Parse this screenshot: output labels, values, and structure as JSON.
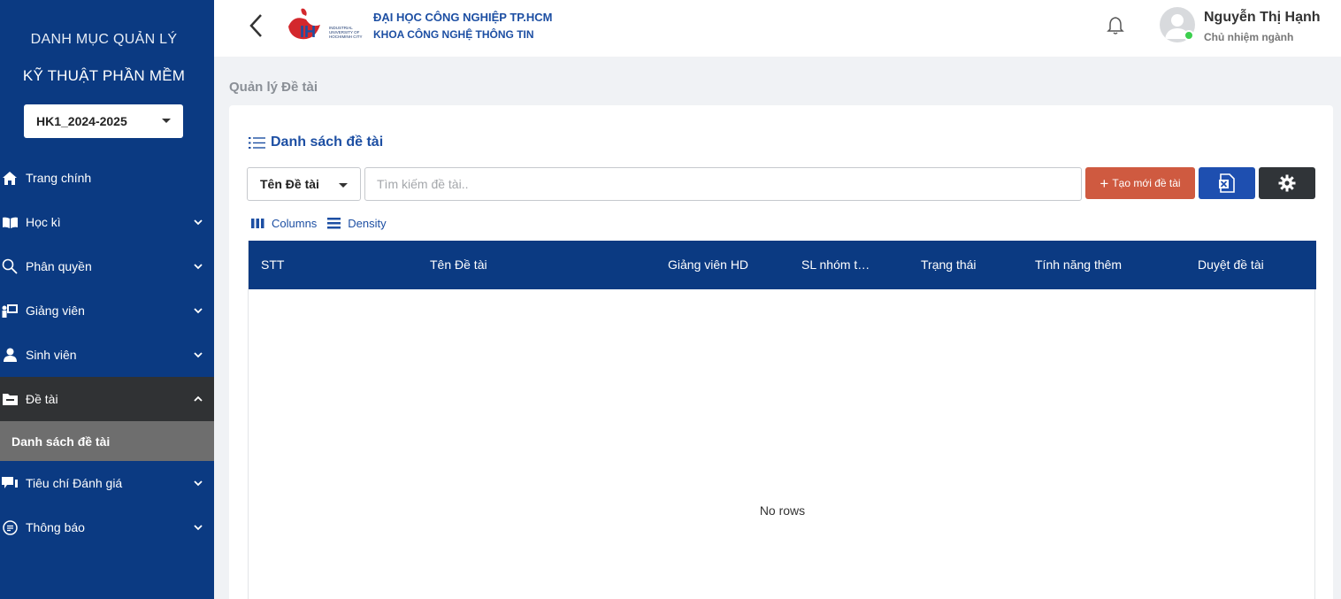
{
  "sidebar": {
    "title_line1": "DANH MỤC QUẢN LÝ",
    "title_line2": "KỸ THUẬT PHẦN MỀM",
    "term_value": "HK1_2024-2025",
    "items": [
      {
        "label": "Trang chính",
        "icon": "home-icon"
      },
      {
        "label": "Học kì",
        "icon": "book-icon"
      },
      {
        "label": "Phân quyền",
        "icon": "key-search-icon"
      },
      {
        "label": "Giảng viên",
        "icon": "lecturer-icon"
      },
      {
        "label": "Sinh viên",
        "icon": "student-icon"
      },
      {
        "label": "Đề tài",
        "icon": "folder-icon"
      },
      {
        "label": "Tiêu chí Đánh giá",
        "icon": "chat-icon"
      },
      {
        "label": "Thông báo",
        "icon": "message-icon"
      }
    ],
    "sub_item": "Danh sách đề tài"
  },
  "header": {
    "university": "ĐẠI HỌC CÔNG NGHIỆP TP.HCM",
    "faculty": "KHOA CÔNG NGHỆ THÔNG TIN",
    "logo_text": "INDUSTRIAL UNIVERSITY OF HOCHIMINH CITY",
    "user_name": "Nguyễn Thị Hạnh",
    "user_role": "Chủ nhiệm ngành"
  },
  "breadcrumb": "Quản lý Đề tài",
  "card": {
    "title": "Danh sách đề tài",
    "filter_value": "Tên Đề tài",
    "search_placeholder": "Tìm kiếm đề tài..",
    "new_button": "Tạo mới đề tài",
    "columns_label": "Columns",
    "density_label": "Density"
  },
  "table": {
    "headers": [
      "STT",
      "Tên Đề tài",
      "Giảng viên HD",
      "SL nhóm t…",
      "Trạng thái",
      "Tính năng thêm",
      "Duyệt đề tài"
    ],
    "empty_text": "No rows"
  },
  "colors": {
    "primary": "#0b3a82",
    "accent_red": "#cf5a40",
    "excel_blue": "#1e4fb0",
    "dark": "#303438"
  }
}
